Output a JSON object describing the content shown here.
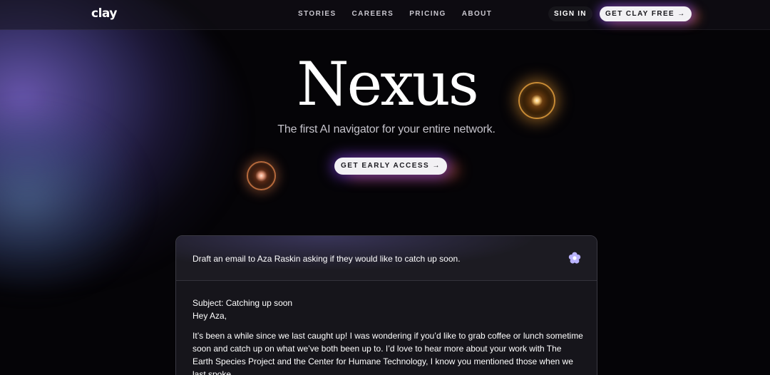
{
  "nav": {
    "logo": "clay",
    "links": [
      "STORIES",
      "CAREERS",
      "PRICING",
      "ABOUT"
    ],
    "sign_in": "SIGN IN",
    "cta": "GET CLAY FREE →"
  },
  "hero": {
    "title": "Nexus",
    "subtitle": "The first AI navigator for your entire network.",
    "cta": "GET EARLY ACCESS →"
  },
  "chat": {
    "prompt": "Draft an email to Aza Raskin asking if they would like to catch up soon.",
    "prompt_icon": "flower-icon",
    "subject": "Subject: Catching up soon",
    "greeting": "Hey Aza,",
    "body": "It’s been a while since we last caught up! I was wondering if you’d like to grab coffee or lunch sometime soon and catch up on what we’ve both been up to. I’d love to hear more about your work with The Earth Species Project and the Center for Humane Technology, I know you mentioned those when we last spoke."
  },
  "colors": {
    "background": "#050407",
    "card": "#16151b",
    "button_light": "#f2f1f4",
    "accent_purple": "#8c46ff",
    "accent_orange": "#ff6e3c",
    "orb_gold": "#c88b35"
  }
}
